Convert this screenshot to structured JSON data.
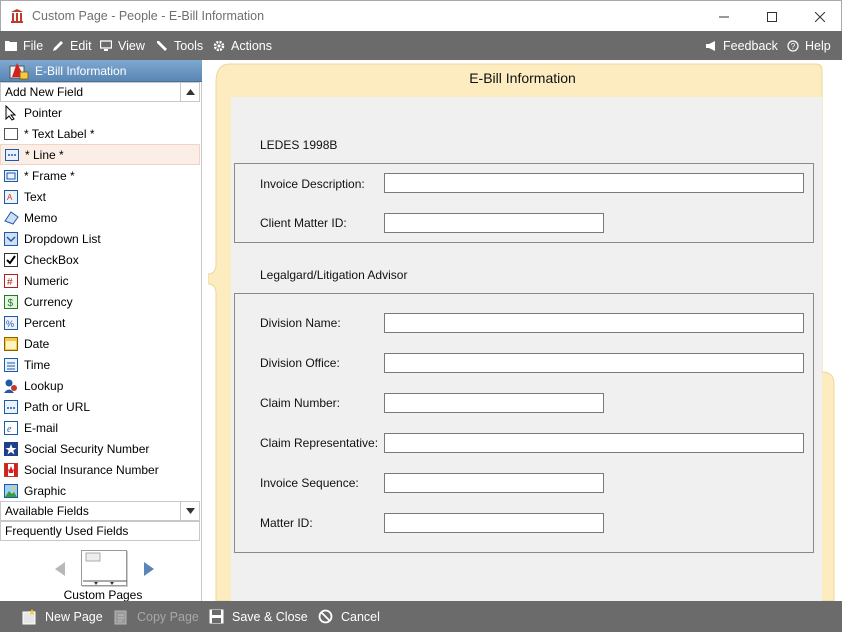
{
  "window": {
    "title": "Custom Page - People - E-Bill Information"
  },
  "menu": {
    "file": "File",
    "edit": "Edit",
    "view": "View",
    "tools": "Tools",
    "actions": "Actions",
    "feedback": "Feedback",
    "help": "Help"
  },
  "left_panel": {
    "header": "E-Bill Information",
    "add_new_field": "Add New Field",
    "fields": [
      {
        "label": "Pointer",
        "icon": "pointer-icon"
      },
      {
        "label": "* Text Label *",
        "icon": "text-label-icon"
      },
      {
        "label": "* Line *",
        "icon": "line-icon"
      },
      {
        "label": "* Frame *",
        "icon": "frame-icon"
      },
      {
        "label": "Text",
        "icon": "text-icon"
      },
      {
        "label": "Memo",
        "icon": "memo-icon"
      },
      {
        "label": "Dropdown List",
        "icon": "dropdown-icon"
      },
      {
        "label": "CheckBox",
        "icon": "checkbox-icon"
      },
      {
        "label": "Numeric",
        "icon": "numeric-icon"
      },
      {
        "label": "Currency",
        "icon": "currency-icon"
      },
      {
        "label": "Percent",
        "icon": "percent-icon"
      },
      {
        "label": "Date",
        "icon": "date-icon"
      },
      {
        "label": "Time",
        "icon": "time-icon"
      },
      {
        "label": "Lookup",
        "icon": "lookup-icon"
      },
      {
        "label": "Path or URL",
        "icon": "path-icon"
      },
      {
        "label": "E-mail",
        "icon": "email-icon"
      },
      {
        "label": "Social Security Number",
        "icon": "ssn-icon"
      },
      {
        "label": "Social Insurance Number",
        "icon": "sin-icon"
      },
      {
        "label": "Graphic",
        "icon": "graphic-icon"
      }
    ],
    "available_fields": "Available Fields",
    "frequently_used": "Frequently Used Fields",
    "custom_pages": "Custom Pages"
  },
  "form": {
    "title": "E-Bill Information",
    "group1": {
      "label": "LEDES 1998B",
      "fields": [
        {
          "label": "Invoice Description:",
          "value": ""
        },
        {
          "label": "Client Matter ID:",
          "value": ""
        }
      ]
    },
    "group2": {
      "label": "Legalgard/Litigation Advisor",
      "fields": [
        {
          "label": "Division Name:",
          "value": ""
        },
        {
          "label": "Division Office:",
          "value": ""
        },
        {
          "label": "Claim Number:",
          "value": ""
        },
        {
          "label": "Claim Representative:",
          "value": ""
        },
        {
          "label": "Invoice Sequence:",
          "value": ""
        },
        {
          "label": "Matter ID:",
          "value": ""
        }
      ]
    }
  },
  "bottom": {
    "new_page": "New Page",
    "copy_page": "Copy Page",
    "save_close": "Save & Close",
    "cancel": "Cancel"
  },
  "colors": {
    "toolbar_bg": "#6b6b6b",
    "tab_bg": "#fcecc0",
    "form_bg": "#f0f0f0"
  }
}
